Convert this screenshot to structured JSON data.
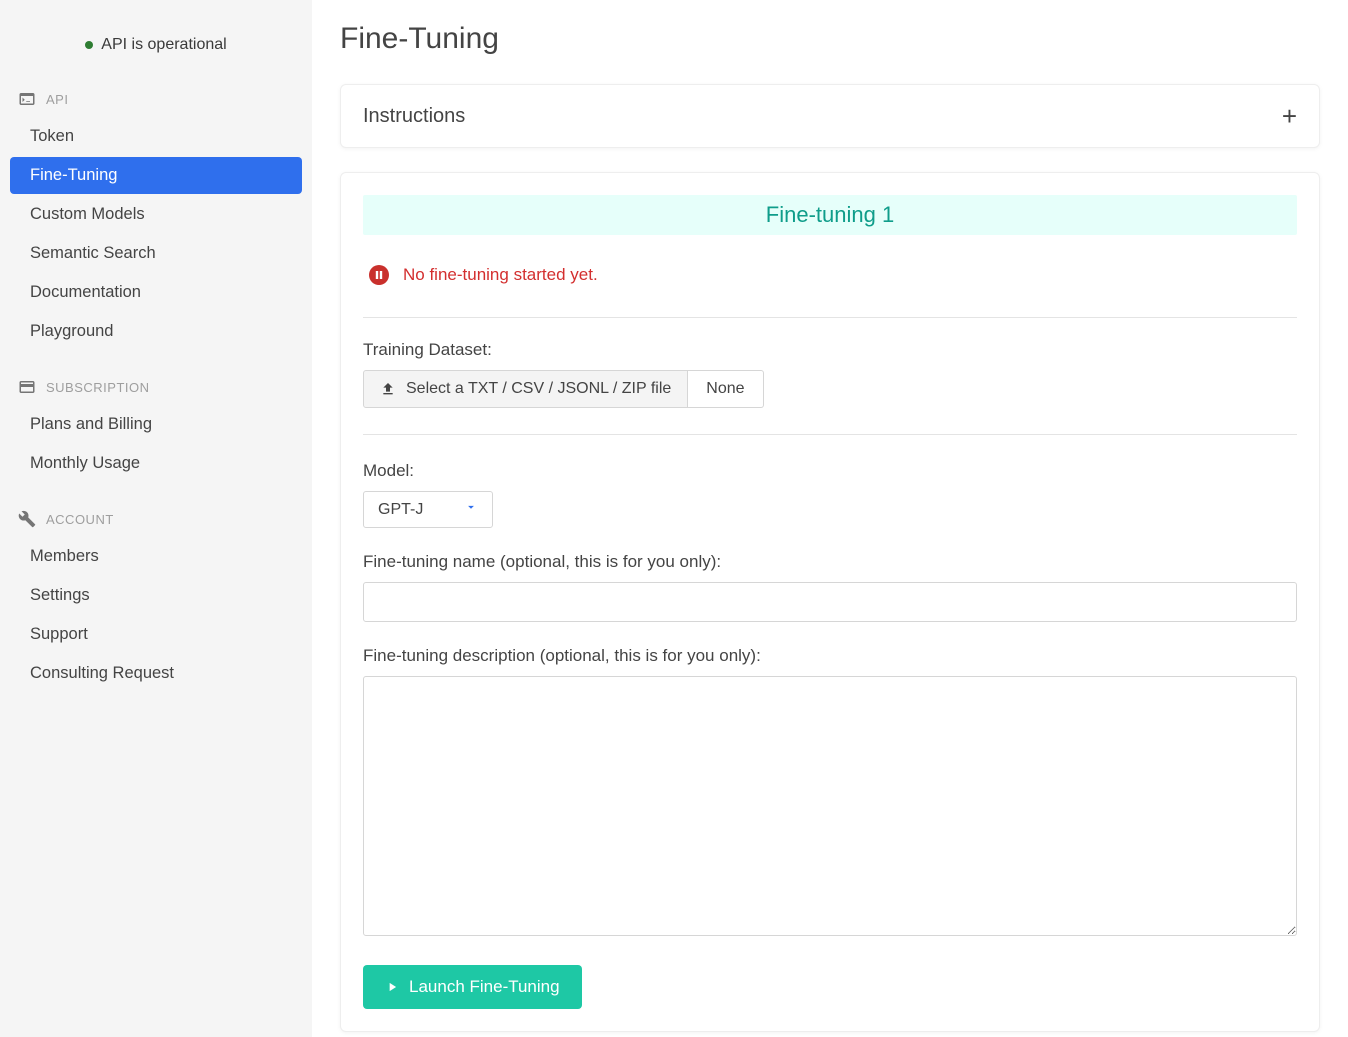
{
  "status": {
    "text": "API is operational"
  },
  "sidebar": {
    "sections": {
      "api": {
        "label": "API",
        "items": [
          "Token",
          "Fine-Tuning",
          "Custom Models",
          "Semantic Search",
          "Documentation",
          "Playground"
        ]
      },
      "subscription": {
        "label": "SUBSCRIPTION",
        "items": [
          "Plans and Billing",
          "Monthly Usage"
        ]
      },
      "account": {
        "label": "ACCOUNT",
        "items": [
          "Members",
          "Settings",
          "Support",
          "Consulting Request"
        ]
      }
    },
    "active": "Fine-Tuning"
  },
  "page": {
    "title": "Fine-Tuning"
  },
  "instructions": {
    "title": "Instructions"
  },
  "ft": {
    "banner": "Fine-tuning 1",
    "status": "No fine-tuning started yet.",
    "dataset_label": "Training Dataset:",
    "select_file_label": "Select a TXT / CSV / JSONL / ZIP file",
    "file_value": "None",
    "model_label": "Model:",
    "model_value": "GPT-J",
    "name_label": "Fine-tuning name (optional, this is for you only):",
    "name_value": "",
    "desc_label": "Fine-tuning description (optional, this is for you only):",
    "desc_value": "",
    "launch_label": "Launch Fine-Tuning"
  }
}
